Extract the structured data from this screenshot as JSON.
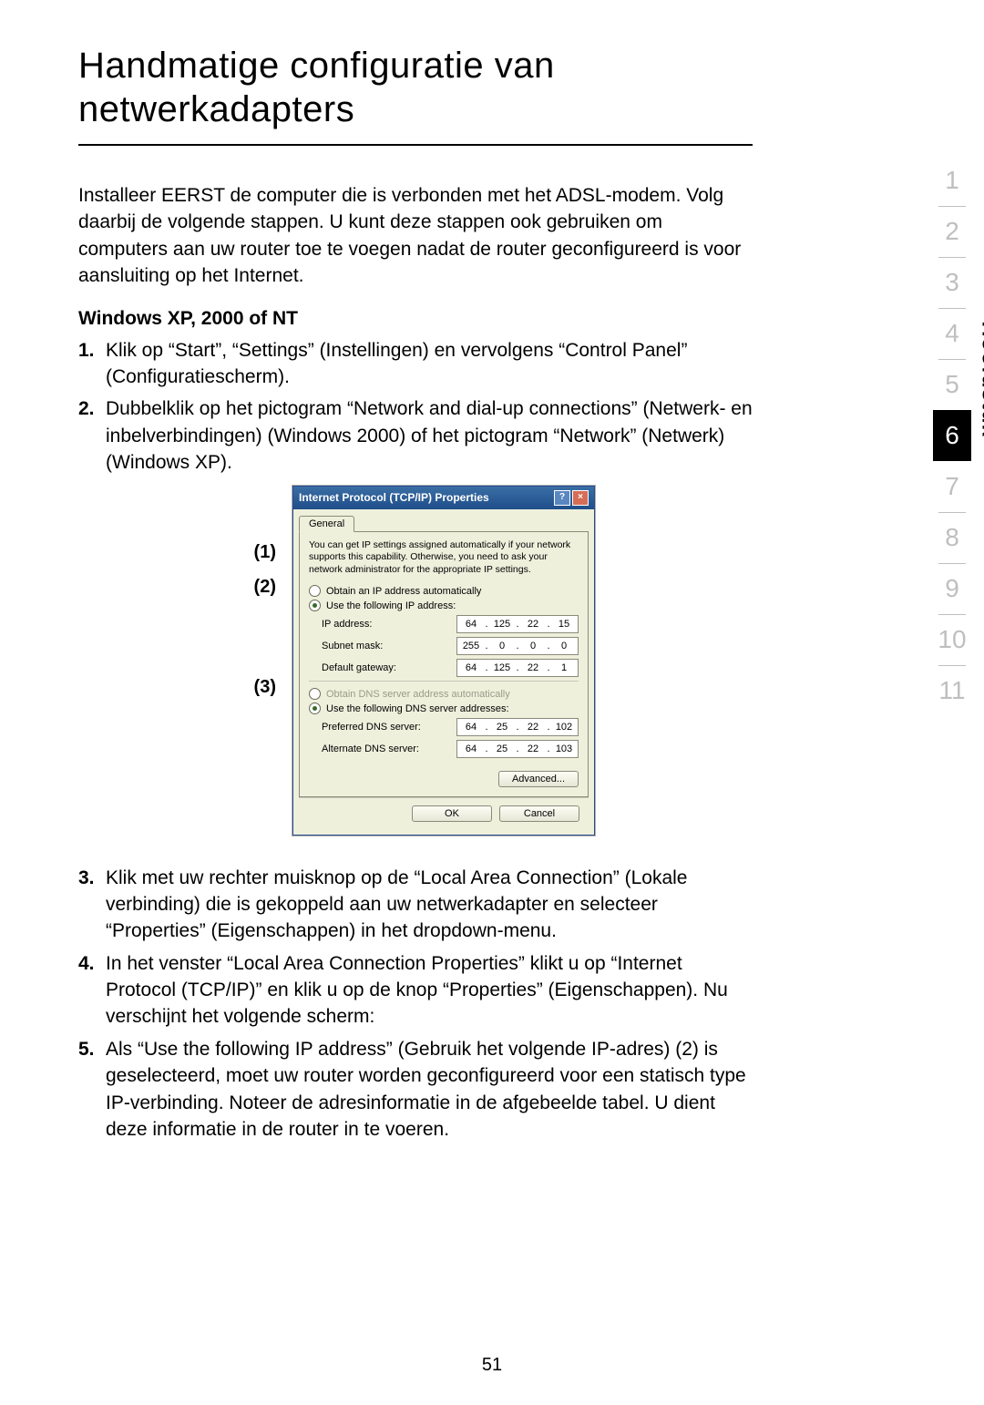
{
  "page": {
    "title": "Handmatige configuratie van netwerkadapters",
    "intro": "Installeer EERST de computer die is verbonden met het ADSL-modem. Volg daarbij de volgende stappen. U kunt deze stappen ook gebruiken om computers aan uw router toe te voegen nadat de router geconfigureerd is voor aansluiting op het Internet.",
    "subhead": "Windows XP, 2000 of NT",
    "steps": {
      "s1": {
        "num": "1.",
        "text": "Klik op “Start”, “Settings” (Instellingen) en vervolgens “Control Panel” (Configuratiescherm)."
      },
      "s2": {
        "num": "2.",
        "text": "Dubbelklik op het pictogram “Network and dial-up connections” (Netwerk- en inbelverbindingen) (Windows 2000) of het pictogram “Network” (Netwerk) (Windows XP)."
      },
      "s3": {
        "num": "3.",
        "text": "Klik met uw rechter muisknop op de “Local Area Connection” (Lokale verbinding) die is gekoppeld aan uw netwerkadapter en selecteer “Properties” (Eigenschappen) in het dropdown-menu."
      },
      "s4": {
        "num": "4.",
        "text": "In het venster “Local Area Connection Properties” klikt u op “Internet Protocol (TCP/IP)” en klik u op de knop “Properties” (Eigenschappen). Nu verschijnt het volgende scherm:"
      },
      "s5": {
        "num": "5.",
        "text": "Als “Use the following IP address” (Gebruik het volgende IP-adres) (2) is geselecteerd, moet uw router worden geconfigureerd voor een statisch type IP-verbinding. Noteer de adresinformatie in de afgebeelde tabel. U dient deze informatie in de router in te voeren."
      }
    },
    "callouts": {
      "c1": "(1)",
      "c2": "(2)",
      "c3": "(3)"
    },
    "page_number": "51"
  },
  "sidebar": {
    "label": "Hoofdstuk",
    "chapters": [
      "1",
      "2",
      "3",
      "4",
      "5",
      "6",
      "7",
      "8",
      "9",
      "10",
      "11"
    ],
    "active": "6"
  },
  "dialog": {
    "title": "Internet Protocol (TCP/IP) Properties",
    "help": "?",
    "close": "×",
    "tab": "General",
    "desc": "You can get IP settings assigned automatically if your network supports this capability. Otherwise, you need to ask your network administrator for the appropriate IP settings.",
    "radio_auto_ip": "Obtain an IP address automatically",
    "radio_use_ip": "Use the following IP address:",
    "ip_label": "IP address:",
    "subnet_label": "Subnet mask:",
    "gateway_label": "Default gateway:",
    "radio_auto_dns": "Obtain DNS server address automatically",
    "radio_use_dns": "Use the following DNS server addresses:",
    "pref_dns_label": "Preferred DNS server:",
    "alt_dns_label": "Alternate DNS server:",
    "ip": {
      "o1": "64",
      "o2": "125",
      "o3": "22",
      "o4": "15"
    },
    "subnet": {
      "o1": "255",
      "o2": "0",
      "o3": "0",
      "o4": "0"
    },
    "gateway": {
      "o1": "64",
      "o2": "125",
      "o3": "22",
      "o4": "1"
    },
    "pdns": {
      "o1": "64",
      "o2": "25",
      "o3": "22",
      "o4": "102"
    },
    "adns": {
      "o1": "64",
      "o2": "25",
      "o3": "22",
      "o4": "103"
    },
    "advanced": "Advanced...",
    "ok": "OK",
    "cancel": "Cancel"
  }
}
